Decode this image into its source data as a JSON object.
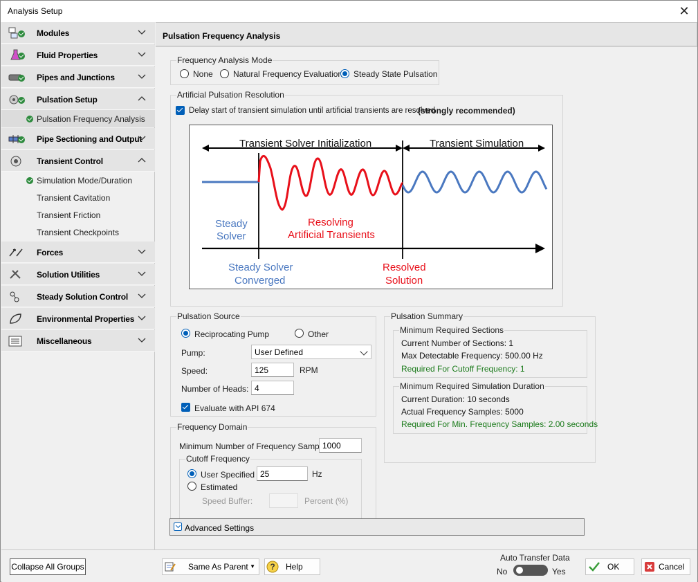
{
  "window": {
    "title": "Analysis Setup"
  },
  "sidebar": {
    "groups": [
      {
        "label": "Modules",
        "status": "ok"
      },
      {
        "label": "Fluid Properties",
        "status": "ok"
      },
      {
        "label": "Pipes and Junctions",
        "status": "ok"
      },
      {
        "label": "Pulsation Setup",
        "status": "expanded"
      },
      {
        "label": "Pipe Sectioning and Output",
        "status": "ok"
      },
      {
        "label": "Transient Control",
        "status": "expanded"
      },
      {
        "label": "Forces"
      },
      {
        "label": "Solution Utilities"
      },
      {
        "label": "Steady Solution Control"
      },
      {
        "label": "Environmental Properties"
      },
      {
        "label": "Miscellaneous"
      }
    ],
    "pulsation_items": [
      {
        "label": "Pulsation Frequency Analysis",
        "selected": true
      }
    ],
    "transient_items": [
      {
        "label": "Simulation Mode/Duration"
      },
      {
        "label": "Transient Cavitation"
      },
      {
        "label": "Transient Friction"
      },
      {
        "label": "Transient Checkpoints"
      }
    ]
  },
  "main": {
    "header": "Pulsation Frequency Analysis",
    "mode": {
      "legend": "Frequency Analysis Mode",
      "options": [
        "None",
        "Natural Frequency Evaluation",
        "Steady State Pulsation"
      ],
      "selected": "Steady State Pulsation"
    },
    "artificial": {
      "legend": "Artificial Pulsation Resolution",
      "checkbox_label": "Delay start of transient simulation until artificial transients are resolved",
      "checkbox_bold": "(strongly recommended)",
      "diagram": {
        "init_label": "Transient Solver Initialization",
        "sim_label": "Transient Simulation",
        "steady_solver_1": "Steady",
        "steady_solver_2": "Solver",
        "resolving_1": "Resolving",
        "resolving_2": "Artificial Transients",
        "converged_1": "Steady Solver",
        "converged_2": "Converged",
        "resolved_1": "Resolved",
        "resolved_2": "Solution"
      }
    },
    "source": {
      "legend": "Pulsation Source",
      "options": [
        "Reciprocating Pump",
        "Other"
      ],
      "selected": "Reciprocating Pump",
      "pump_label": "Pump:",
      "pump_value": "User Defined",
      "speed_label": "Speed:",
      "speed_value": "125",
      "speed_unit": "RPM",
      "heads_label": "Number of Heads:",
      "heads_value": "4",
      "api_label": "Evaluate with API 674"
    },
    "domain": {
      "legend": "Frequency Domain",
      "min_samples_label": "Minimum Number of Frequency Samples:",
      "min_samples_value": "1000",
      "cutoff_legend": "Cutoff Frequency",
      "user_specified": "User Specified",
      "user_value": "25",
      "user_unit": "Hz",
      "estimated": "Estimated",
      "speed_buffer": "Speed Buffer:",
      "percent": "Percent (%)"
    },
    "summary": {
      "legend": "Pulsation Summary",
      "sections": {
        "legend": "Minimum Required Sections",
        "line1": "Current Number of Sections: 1",
        "line2": "Max Detectable Frequency: 500.00 Hz",
        "line3": "Required For Cutoff Frequency: 1"
      },
      "duration": {
        "legend": "Minimum Required Simulation Duration",
        "line1": "Current Duration: 10 seconds",
        "line2": "Actual Frequency Samples: 5000",
        "line3": "Required For Min. Frequency Samples: 2.00 seconds"
      }
    },
    "advanced": "Advanced Settings"
  },
  "footer": {
    "collapse": "Collapse All Groups",
    "same_as_parent": "Same As Parent",
    "help": "Help",
    "auto_transfer": "Auto Transfer Data",
    "no": "No",
    "yes": "Yes",
    "ok": "OK",
    "cancel": "Cancel"
  },
  "colors": {
    "accent": "#005fb8",
    "ok_green": "#2e8b3e",
    "red": "#e8101a",
    "blue": "#4a78c0"
  }
}
